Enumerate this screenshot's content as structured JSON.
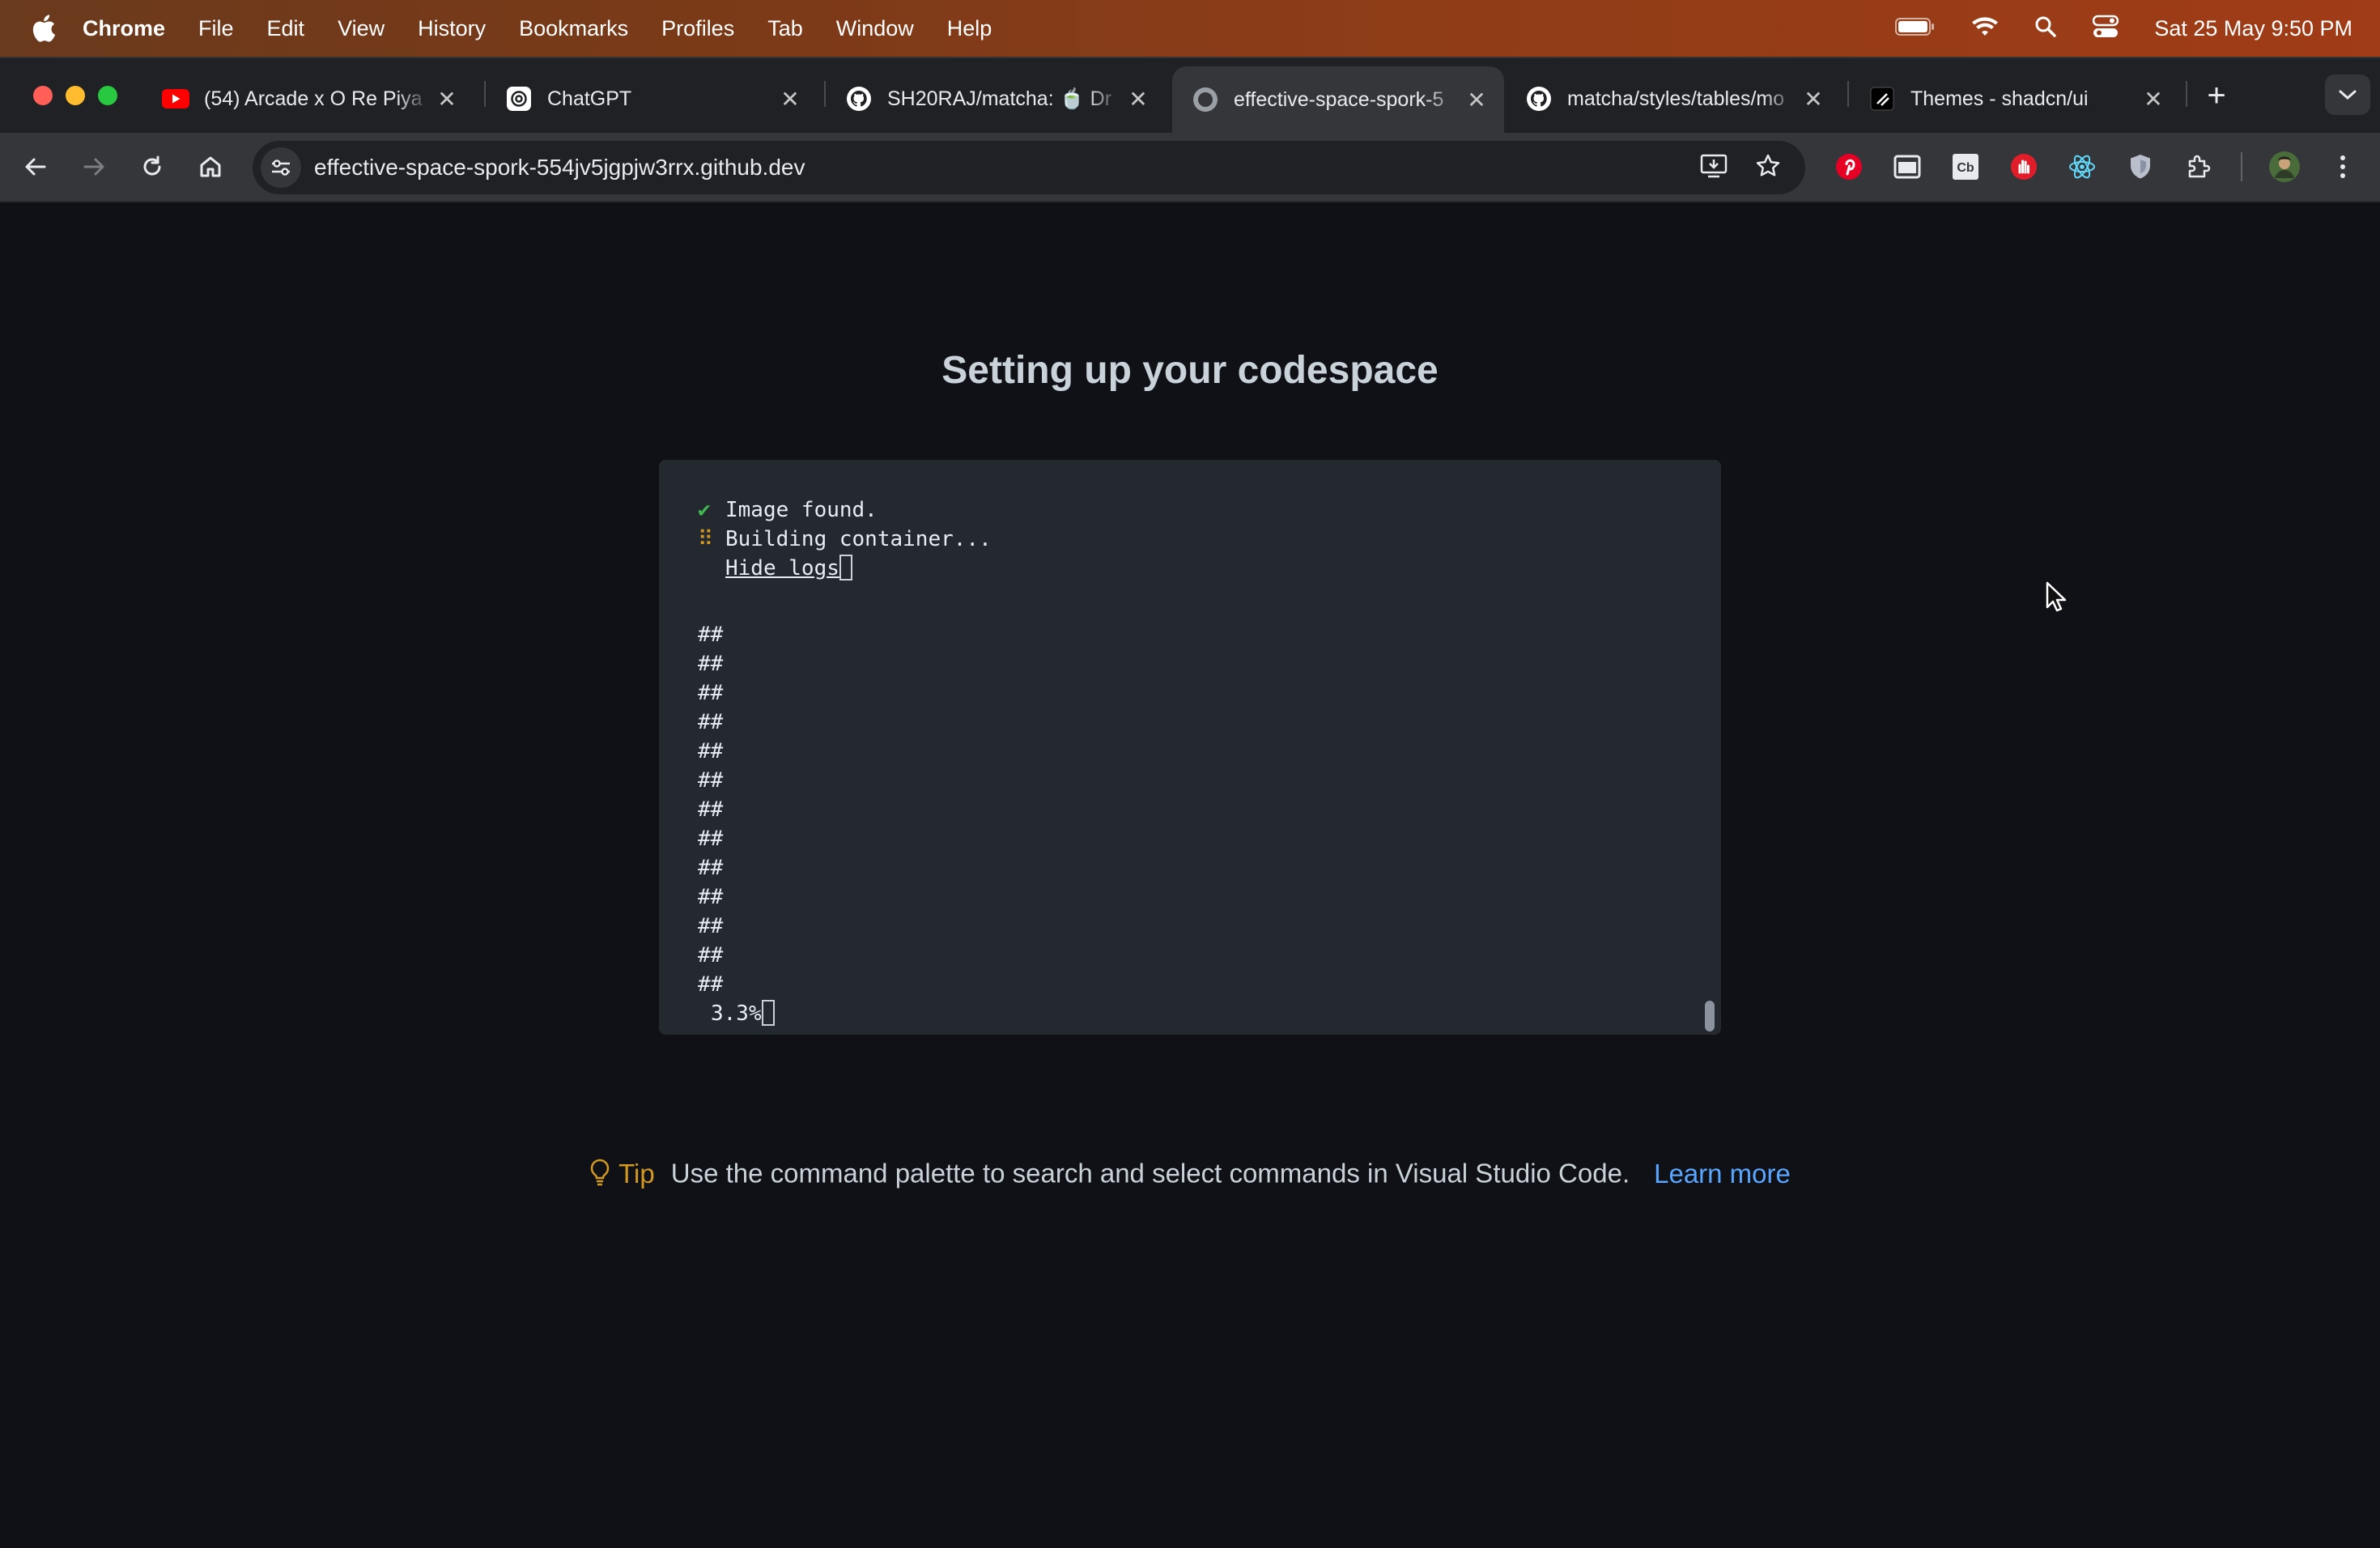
{
  "menubar": {
    "app_name": "Chrome",
    "items": [
      "File",
      "Edit",
      "View",
      "History",
      "Bookmarks",
      "Profiles",
      "Tab",
      "Window",
      "Help"
    ],
    "clock": "Sat 25 May  9:50 PM"
  },
  "tabs": [
    {
      "title": "(54) Arcade x O Re Piya",
      "favicon": "youtube-icon",
      "active": false
    },
    {
      "title": "ChatGPT",
      "favicon": "chatgpt-icon",
      "active": false
    },
    {
      "title": "SH20RAJ/matcha: 🍵 Dr",
      "favicon": "github-icon",
      "active": false
    },
    {
      "title": "effective-space-spork-5",
      "favicon": "github-icon",
      "active": true
    },
    {
      "title": "matcha/styles/tables/mo",
      "favicon": "github-icon",
      "active": false
    },
    {
      "title": "Themes - shadcn/ui",
      "favicon": "shadcn-icon",
      "active": false
    }
  ],
  "toolbar": {
    "url": "effective-space-spork-554jv5jgpjw3rrx.github.dev"
  },
  "page": {
    "title": "Setting up your codespace",
    "terminal": {
      "line1": "Image found.",
      "line2": "Building container...",
      "hide_logs": "Hide logs",
      "hash_lines": [
        "##",
        "##",
        "##",
        "##",
        "##",
        "##",
        "##",
        "##",
        "##",
        "##",
        "##",
        "##",
        "##"
      ],
      "progress": "3.3%"
    },
    "tip": {
      "label": "Tip",
      "text": "Use the command palette to search and select commands in Visual Studio Code.",
      "link": "Learn more"
    }
  },
  "colors": {
    "background": "#0f1117",
    "terminal_bg": "#24292f",
    "link": "#58a6ff",
    "tip": "#d29922",
    "success": "#3fb950"
  }
}
